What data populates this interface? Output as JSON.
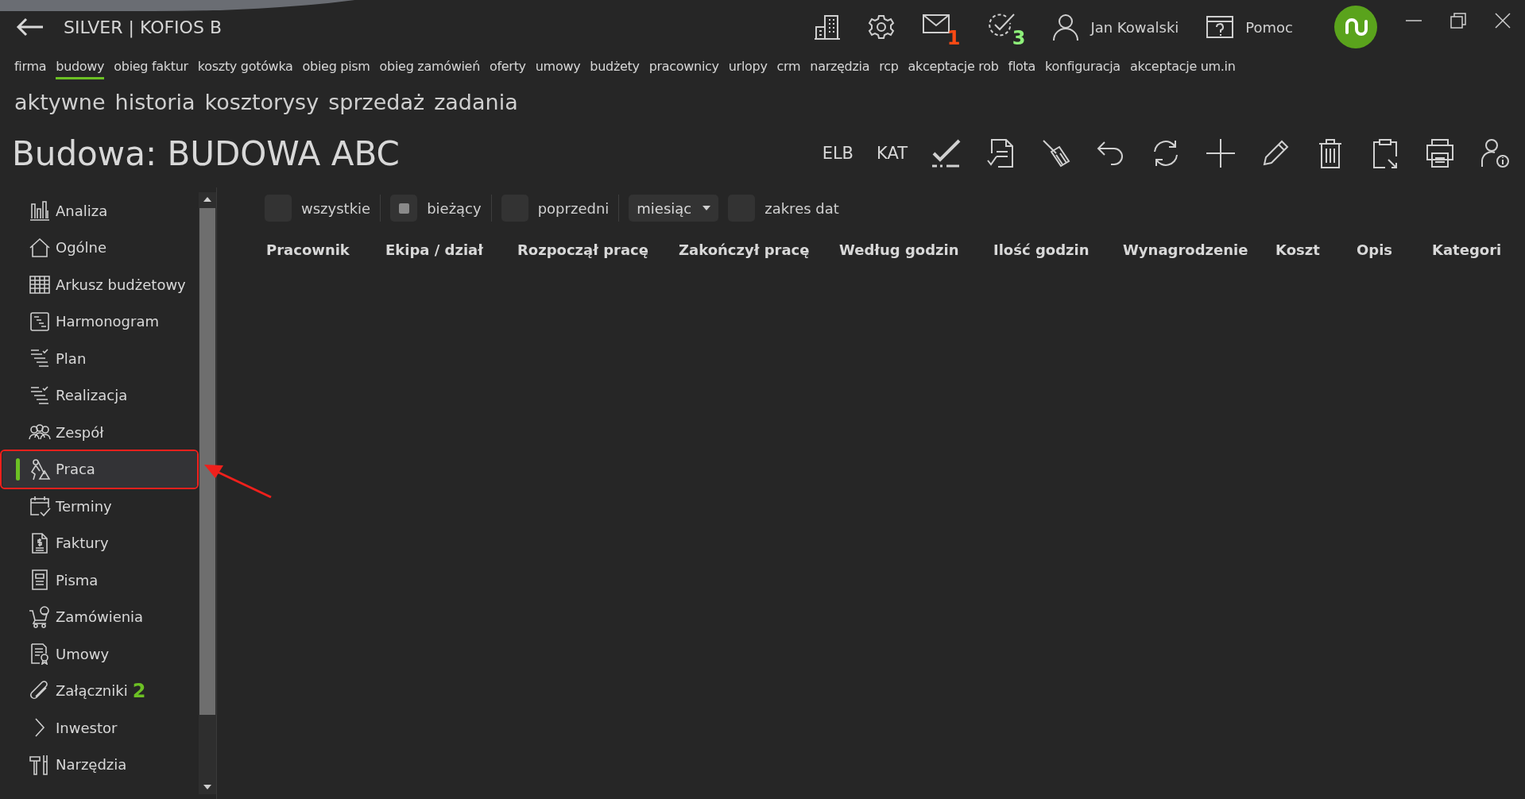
{
  "window": {
    "title": "SILVER | KOFIOS B"
  },
  "header": {
    "user": "Jan Kowalski",
    "help": "Pomoc",
    "mail_count": "1",
    "tasks_count": "3"
  },
  "nav": [
    {
      "label": "firma",
      "selected": false
    },
    {
      "label": "budowy",
      "selected": true
    },
    {
      "label": "obieg faktur",
      "selected": false
    },
    {
      "label": "koszty gotówka",
      "selected": false
    },
    {
      "label": "obieg pism",
      "selected": false
    },
    {
      "label": "obieg zamówień",
      "selected": false
    },
    {
      "label": "oferty",
      "selected": false
    },
    {
      "label": "umowy",
      "selected": false
    },
    {
      "label": "budżety",
      "selected": false
    },
    {
      "label": "pracownicy",
      "selected": false
    },
    {
      "label": "urlopy",
      "selected": false
    },
    {
      "label": "crm",
      "selected": false
    },
    {
      "label": "narzędzia",
      "selected": false
    },
    {
      "label": "rcp",
      "selected": false
    },
    {
      "label": "akceptacje rob",
      "selected": false
    },
    {
      "label": "flota",
      "selected": false
    },
    {
      "label": "konfiguracja",
      "selected": false
    },
    {
      "label": "akceptacje um.in",
      "selected": false
    }
  ],
  "subtabs": [
    "aktywne",
    "historia",
    "kosztorysy",
    "sprzedaż",
    "zadania"
  ],
  "page_title": "Budowa: BUDOWA ABC",
  "toolbar": {
    "text_buttons": [
      "ELB",
      "KAT"
    ]
  },
  "sidebar": {
    "items": [
      {
        "kind": "chart",
        "label": "Analiza",
        "selected": false,
        "highlighted": false
      },
      {
        "kind": "house",
        "label": "Ogólne",
        "selected": false,
        "highlighted": false
      },
      {
        "kind": "grid",
        "label": "Arkusz budżetowy",
        "selected": false,
        "highlighted": false
      },
      {
        "kind": "steps",
        "label": "Harmonogram",
        "selected": false,
        "highlighted": false
      },
      {
        "kind": "list",
        "label": "Plan",
        "selected": false,
        "highlighted": false
      },
      {
        "kind": "list",
        "label": "Realizacja",
        "selected": false,
        "highlighted": false
      },
      {
        "kind": "people",
        "label": "Zespół",
        "selected": false,
        "highlighted": false
      },
      {
        "kind": "worker",
        "label": "Praca",
        "selected": true,
        "highlighted": true
      },
      {
        "kind": "calendar",
        "label": "Terminy",
        "selected": false,
        "highlighted": false
      },
      {
        "kind": "invoice",
        "label": "Faktury",
        "selected": false,
        "highlighted": false
      },
      {
        "kind": "doc",
        "label": "Pisma",
        "selected": false,
        "highlighted": false
      },
      {
        "kind": "cart",
        "label": "Zamówienia",
        "selected": false,
        "highlighted": false
      },
      {
        "kind": "contract",
        "label": "Umowy",
        "selected": false,
        "highlighted": false
      },
      {
        "kind": "clip",
        "label": "Załączniki",
        "badge": "2",
        "selected": false,
        "highlighted": false
      },
      {
        "kind": "chevron",
        "label": "Inwestor",
        "selected": false,
        "highlighted": false
      },
      {
        "kind": "tools",
        "label": "Narzędzia",
        "selected": false,
        "highlighted": false
      }
    ]
  },
  "filters": [
    {
      "kind": "checkbox",
      "label": "wszystkie",
      "checked": false
    },
    {
      "kind": "checkbox",
      "label": "bieżący",
      "checked": true
    },
    {
      "kind": "checkbox",
      "label": "poprzedni",
      "checked": false
    },
    {
      "kind": "dropdown",
      "label": "miesiąc"
    },
    {
      "kind": "checkbox",
      "label": "zakres dat",
      "checked": false
    }
  ],
  "table": {
    "columns": [
      "Pracownik",
      "Ekipa / dział",
      "Rozpoczął pracę",
      "Zakończył pracę",
      "Według godzin",
      "Ilość godzin",
      "Wynagrodzenie",
      "Koszt",
      "Opis",
      "Kategori"
    ]
  }
}
